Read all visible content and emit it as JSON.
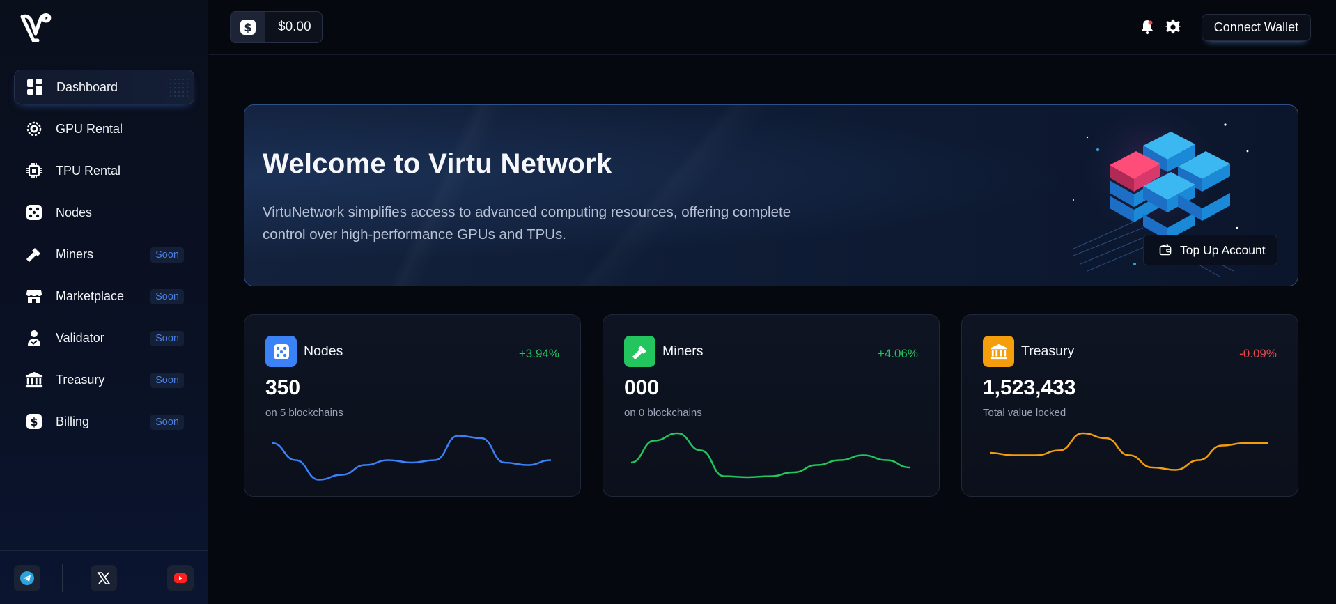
{
  "sidebar": {
    "logo_icon": "v-logo-icon",
    "items": [
      {
        "label": "Dashboard",
        "icon": "dashboard-grid-icon",
        "active": true
      },
      {
        "label": "GPU Rental",
        "icon": "chip-icon"
      },
      {
        "label": "TPU Rental",
        "icon": "processor-icon"
      },
      {
        "label": "Nodes",
        "icon": "dice-icon"
      },
      {
        "label": "Miners",
        "icon": "pickaxe-icon",
        "badge": "Soon"
      },
      {
        "label": "Marketplace",
        "icon": "store-icon",
        "badge": "Soon"
      },
      {
        "label": "Validator",
        "icon": "user-check-icon",
        "badge": "Soon"
      },
      {
        "label": "Treasury",
        "icon": "bank-icon",
        "badge": "Soon"
      },
      {
        "label": "Billing",
        "icon": "dollar-icon",
        "badge": "Soon"
      }
    ],
    "social": [
      "telegram-icon",
      "x-icon",
      "youtube-icon"
    ]
  },
  "header": {
    "balance": "$0.00",
    "connect_label": "Connect Wallet"
  },
  "banner": {
    "title": "Welcome to Virtu Network",
    "description": "VirtuNetwork simplifies access to advanced computing resources, offering complete control over high-performance GPUs and TPUs.",
    "button_label": "Top Up Account"
  },
  "cards": [
    {
      "title": "Nodes",
      "change": "+3.94%",
      "value": "350",
      "subtitle": "on 5 blockchains",
      "color": "#3b82f6",
      "change_color": "#22c55e"
    },
    {
      "title": "Miners",
      "change": "+4.06%",
      "value": "000",
      "subtitle": "on 0 blockchains",
      "color": "#22c55e",
      "change_color": "#22c55e"
    },
    {
      "title": "Treasury",
      "change": "-0.09%",
      "value": "1,523,433",
      "subtitle": "Total value locked",
      "color": "#f59e0b",
      "change_color": "#e5484d"
    }
  ],
  "sparklines": [
    [
      0.2,
      0.55,
      0.95,
      0.85,
      0.65,
      0.55,
      0.6,
      0.55,
      0.05,
      0.1,
      0.6,
      0.65,
      0.55
    ],
    [
      0.6,
      0.15,
      0.0,
      0.35,
      0.88,
      0.9,
      0.88,
      0.8,
      0.65,
      0.55,
      0.45,
      0.55,
      0.7
    ],
    [
      0.4,
      0.45,
      0.45,
      0.35,
      0.0,
      0.1,
      0.45,
      0.7,
      0.75,
      0.55,
      0.25,
      0.2,
      0.2
    ]
  ]
}
